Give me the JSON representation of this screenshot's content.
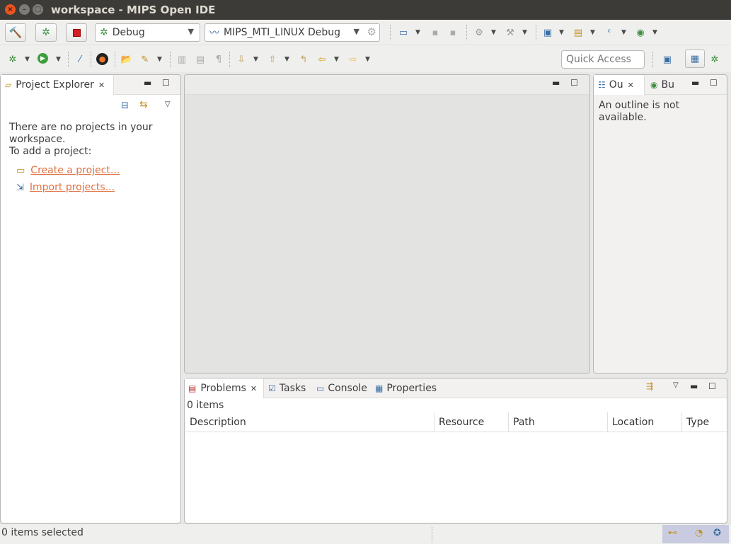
{
  "window": {
    "title": "workspace - MIPS Open IDE",
    "close_glyph": "×",
    "minimize_glyph": "–",
    "maximize_glyph": "□"
  },
  "toolbar": {
    "debug_combo": "Debug",
    "config_combo": "MIPS_MTI_LINUX Debug",
    "quick_access_placeholder": "Quick Access"
  },
  "project_explorer": {
    "tab_label": "Project Explorer",
    "empty_message_line1": "There are no projects in your workspace.",
    "empty_message_line2": "To add a project:",
    "create_link": "Create a project...",
    "import_link": "Import projects..."
  },
  "outline": {
    "tab_outline": "Ou",
    "tab_build": "Bu",
    "message": "An outline is not available."
  },
  "bottom_panel": {
    "tabs": [
      "Problems",
      "Tasks",
      "Console",
      "Properties"
    ],
    "items_count": "0 items",
    "columns": [
      "Description",
      "Resource",
      "Path",
      "Location",
      "Type"
    ]
  },
  "status": {
    "selection": "0 items selected"
  },
  "colors": {
    "titlebar": "#3c3b37",
    "link": "#e07040",
    "close_button": "#e95420"
  }
}
